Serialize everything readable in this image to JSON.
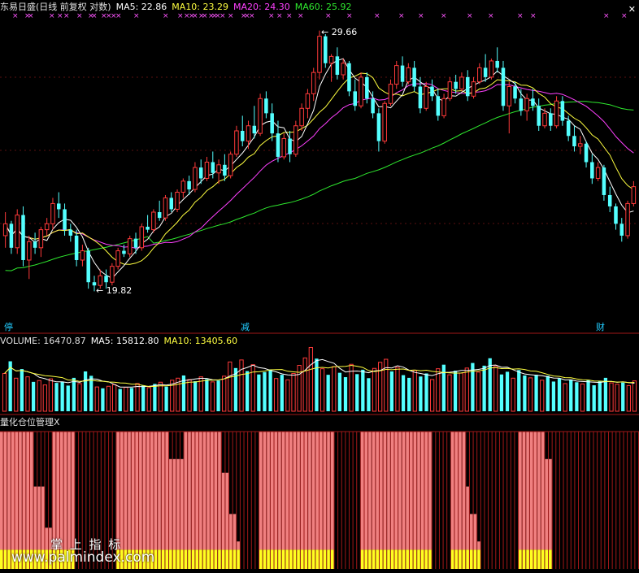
{
  "header": {
    "title": "东易日盛(日线 前复权 对数)",
    "ma5": "MA5: 22.86",
    "ma10": "MA10: 23.29",
    "ma20": "MA20: 24.30",
    "ma60": "MA60: 25.92"
  },
  "price_panel": {
    "high_label": "29.66",
    "low_label": "19.82",
    "close_button": "✕"
  },
  "signal_labels": {
    "left": "停",
    "mid": "减",
    "right": "财"
  },
  "volume_header": {
    "volume": "VOLUME: 16470.87",
    "ma5": "MA5: 15812.80",
    "ma10": "MA10: 13405.60"
  },
  "indicator_title": "量化仓位管理X",
  "watermark": {
    "line1": "掌 上 指 标",
    "line2": "www.palmindex.com"
  },
  "colors": {
    "up": "#ff3a3a",
    "down": "#54ffff",
    "ma5": "#ffffff",
    "ma10": "#ffff40",
    "ma20": "#ff40ff",
    "ma60": "#2ee82e",
    "position_fill": "#f08080",
    "position_base": "#ffff20",
    "grid": "#a01818",
    "marker": "#ff55ff"
  },
  "chart_data": [
    {
      "type": "candlestick",
      "title": "东易日盛(日线 前复权 对数)",
      "y_scale": "log",
      "annotations": [
        {
          "label": "29.66",
          "kind": "max"
        },
        {
          "label": "19.82",
          "kind": "min"
        }
      ],
      "moving_averages": [
        {
          "name": "MA5",
          "last": 22.86
        },
        {
          "name": "MA10",
          "last": 23.29
        },
        {
          "name": "MA20",
          "last": 24.3
        },
        {
          "name": "MA60",
          "last": 25.92
        }
      ],
      "ohlc": [
        [
          21.6,
          22.4,
          21.2,
          22.0
        ],
        [
          22.0,
          22.1,
          21.0,
          21.2
        ],
        [
          21.2,
          22.5,
          21.0,
          22.3
        ],
        [
          22.3,
          22.6,
          20.6,
          20.8
        ],
        [
          20.8,
          21.6,
          20.2,
          21.4
        ],
        [
          21.4,
          21.7,
          21.0,
          21.2
        ],
        [
          21.2,
          21.9,
          20.9,
          21.8
        ],
        [
          21.8,
          22.2,
          21.6,
          22.0
        ],
        [
          22.0,
          22.9,
          21.8,
          22.7
        ],
        [
          22.7,
          23.1,
          22.2,
          22.5
        ],
        [
          22.5,
          22.7,
          21.6,
          21.8
        ],
        [
          21.8,
          22.0,
          21.4,
          21.6
        ],
        [
          21.6,
          21.8,
          20.6,
          20.8
        ],
        [
          20.8,
          21.3,
          20.6,
          21.1
        ],
        [
          21.1,
          21.2,
          19.9,
          20.1
        ],
        [
          20.1,
          20.3,
          19.82,
          20.0
        ],
        [
          20.0,
          20.5,
          19.9,
          20.3
        ],
        [
          20.3,
          20.5,
          19.9,
          20.1
        ],
        [
          20.1,
          20.7,
          20.0,
          20.6
        ],
        [
          20.6,
          21.2,
          20.5,
          21.1
        ],
        [
          21.1,
          21.3,
          20.9,
          21.0
        ],
        [
          21.0,
          21.6,
          20.9,
          21.5
        ],
        [
          21.5,
          21.7,
          21.0,
          21.2
        ],
        [
          21.2,
          22.0,
          21.1,
          21.9
        ],
        [
          21.9,
          22.3,
          21.7,
          21.8
        ],
        [
          21.8,
          22.5,
          21.7,
          22.4
        ],
        [
          22.4,
          22.8,
          22.1,
          22.2
        ],
        [
          22.2,
          23.0,
          22.1,
          22.9
        ],
        [
          22.9,
          23.1,
          22.4,
          22.5
        ],
        [
          22.5,
          23.2,
          22.4,
          23.1
        ],
        [
          23.1,
          23.6,
          22.9,
          23.5
        ],
        [
          23.5,
          23.7,
          23.0,
          23.2
        ],
        [
          23.2,
          24.2,
          23.1,
          24.0
        ],
        [
          24.0,
          24.3,
          23.4,
          23.6
        ],
        [
          23.6,
          24.4,
          23.5,
          24.2
        ],
        [
          24.2,
          24.6,
          23.6,
          23.8
        ],
        [
          23.8,
          24.3,
          23.4,
          24.1
        ],
        [
          24.1,
          24.5,
          23.5,
          23.7
        ],
        [
          23.7,
          24.6,
          23.6,
          24.5
        ],
        [
          24.5,
          25.6,
          24.4,
          25.4
        ],
        [
          25.4,
          26.0,
          24.8,
          25.0
        ],
        [
          25.0,
          25.8,
          24.7,
          25.6
        ],
        [
          25.6,
          26.4,
          25.1,
          25.3
        ],
        [
          25.3,
          26.9,
          25.2,
          26.7
        ],
        [
          26.7,
          27.0,
          25.9,
          26.1
        ],
        [
          26.1,
          26.5,
          25.0,
          25.3
        ],
        [
          25.3,
          25.8,
          24.2,
          24.4
        ],
        [
          24.4,
          25.3,
          24.3,
          25.1
        ],
        [
          25.1,
          25.4,
          24.2,
          24.5
        ],
        [
          24.5,
          25.8,
          24.4,
          25.6
        ],
        [
          25.6,
          26.5,
          25.4,
          26.3
        ],
        [
          26.3,
          27.1,
          25.9,
          26.9
        ],
        [
          26.9,
          28.0,
          26.6,
          27.8
        ],
        [
          27.8,
          29.66,
          27.5,
          29.4
        ],
        [
          29.4,
          29.5,
          28.0,
          28.2
        ],
        [
          28.2,
          28.6,
          27.4,
          28.5
        ],
        [
          28.5,
          28.9,
          27.5,
          27.7
        ],
        [
          27.7,
          28.4,
          27.5,
          28.2
        ],
        [
          28.2,
          28.3,
          26.8,
          27.0
        ],
        [
          27.0,
          27.5,
          26.2,
          26.4
        ],
        [
          26.4,
          27.8,
          26.3,
          27.6
        ],
        [
          27.6,
          27.8,
          26.5,
          26.7
        ],
        [
          26.7,
          27.0,
          25.9,
          26.1
        ],
        [
          26.1,
          26.3,
          24.6,
          25.0
        ],
        [
          25.0,
          26.6,
          24.9,
          26.5
        ],
        [
          26.5,
          27.5,
          26.4,
          27.3
        ],
        [
          27.3,
          28.3,
          27.1,
          28.1
        ],
        [
          28.1,
          28.5,
          27.2,
          27.4
        ],
        [
          27.4,
          28.2,
          27.3,
          28.0
        ],
        [
          28.0,
          28.3,
          27.0,
          27.2
        ],
        [
          27.2,
          27.6,
          26.1,
          26.3
        ],
        [
          26.3,
          27.4,
          26.2,
          27.2
        ],
        [
          27.2,
          27.5,
          26.6,
          26.8
        ],
        [
          26.8,
          27.1,
          25.8,
          26.0
        ],
        [
          26.0,
          26.9,
          25.9,
          26.7
        ],
        [
          26.7,
          27.6,
          26.6,
          27.4
        ],
        [
          27.4,
          27.7,
          26.9,
          27.1
        ],
        [
          27.1,
          27.8,
          27.0,
          27.6
        ],
        [
          27.6,
          27.9,
          26.6,
          26.8
        ],
        [
          26.8,
          27.6,
          26.7,
          27.4
        ],
        [
          27.4,
          28.2,
          27.3,
          28.0
        ],
        [
          28.0,
          28.6,
          27.4,
          27.6
        ],
        [
          27.6,
          28.4,
          27.5,
          28.3
        ],
        [
          28.3,
          28.9,
          27.8,
          28.0
        ],
        [
          28.0,
          28.3,
          26.2,
          26.4
        ],
        [
          26.4,
          27.4,
          25.3,
          27.2
        ],
        [
          27.2,
          27.4,
          26.5,
          26.7
        ],
        [
          26.7,
          27.1,
          26.0,
          26.2
        ],
        [
          26.2,
          26.9,
          25.8,
          26.7
        ],
        [
          26.7,
          27.1,
          26.2,
          26.4
        ],
        [
          26.4,
          26.7,
          25.4,
          25.6
        ],
        [
          25.6,
          26.3,
          25.5,
          26.1
        ],
        [
          26.1,
          26.3,
          25.4,
          25.6
        ],
        [
          25.6,
          26.8,
          25.5,
          26.6
        ],
        [
          26.6,
          26.8,
          25.6,
          25.8
        ],
        [
          25.8,
          26.0,
          25.0,
          25.2
        ],
        [
          25.2,
          25.6,
          24.6,
          24.8
        ],
        [
          24.8,
          25.2,
          24.5,
          24.9
        ],
        [
          24.9,
          25.0,
          24.0,
          24.2
        ],
        [
          24.2,
          24.5,
          23.4,
          23.6
        ],
        [
          23.6,
          24.2,
          23.5,
          24.0
        ],
        [
          24.0,
          24.1,
          22.8,
          23.0
        ],
        [
          23.0,
          23.3,
          22.4,
          22.6
        ],
        [
          22.6,
          22.7,
          21.8,
          22.0
        ],
        [
          22.0,
          22.2,
          21.4,
          21.6
        ],
        [
          21.6,
          22.8,
          21.5,
          22.7
        ],
        [
          22.7,
          23.5,
          22.6,
          23.3
        ]
      ]
    },
    {
      "type": "bar",
      "title": "VOLUME",
      "series_values": {
        "VOLUME": 16470.87,
        "MA5": 15812.8,
        "MA10": 13405.6
      },
      "values": [
        11200,
        14800,
        9800,
        12500,
        10200,
        8700,
        9100,
        7800,
        9600,
        8400,
        8800,
        7600,
        9900,
        8200,
        11800,
        10500,
        7200,
        6800,
        7400,
        7900,
        6600,
        7100,
        6900,
        8200,
        7700,
        7000,
        8100,
        8600,
        7300,
        9200,
        9800,
        10600,
        9400,
        8900,
        10200,
        9500,
        8700,
        9100,
        10400,
        14600,
        12800,
        15200,
        11900,
        13800,
        10900,
        11600,
        12400,
        9700,
        10800,
        9300,
        11200,
        13600,
        15800,
        18900,
        15600,
        12600,
        10800,
        13200,
        11400,
        10100,
        13900,
        11000,
        12300,
        9800,
        12700,
        14500,
        15400,
        11800,
        13000,
        10700,
        9900,
        12100,
        10300,
        11200,
        9400,
        12600,
        13800,
        10800,
        12000,
        11300,
        12800,
        14300,
        11600,
        13500,
        15700,
        13400,
        10900,
        11700,
        9800,
        12200,
        10600,
        9900,
        10800,
        9200,
        10500,
        8800,
        9700,
        8200,
        9400,
        8600,
        8100,
        9300,
        7700,
        8900,
        9900,
        8400,
        8000,
        8500,
        7600,
        9000
      ],
      "up": [
        true,
        false,
        true,
        false,
        true,
        false,
        true,
        true,
        true,
        false,
        false,
        false,
        false,
        true,
        false,
        false,
        true,
        false,
        true,
        true,
        false,
        true,
        false,
        true,
        false,
        true,
        false,
        true,
        false,
        true,
        true,
        false,
        true,
        false,
        true,
        false,
        true,
        false,
        true,
        true,
        false,
        true,
        false,
        true,
        false,
        false,
        false,
        true,
        false,
        true,
        true,
        true,
        true,
        true,
        false,
        true,
        false,
        true,
        false,
        false,
        true,
        false,
        false,
        false,
        true,
        true,
        true,
        false,
        true,
        false,
        false,
        true,
        false,
        false,
        true,
        true,
        false,
        true,
        false,
        true,
        true,
        false,
        true,
        false,
        false,
        true,
        false,
        false,
        true,
        false,
        false,
        true,
        false,
        true,
        false,
        false,
        false,
        true,
        false,
        false,
        true,
        false,
        false,
        false,
        false,
        true,
        true,
        false,
        true,
        true
      ]
    },
    {
      "type": "bar",
      "title": "量化仓位管理X",
      "position_percent": [
        100,
        100,
        100,
        100,
        100,
        100,
        100,
        100,
        100,
        60,
        60,
        60,
        30,
        30,
        100,
        100,
        100,
        100,
        100,
        100,
        0,
        0,
        0,
        0,
        0,
        0,
        0,
        0,
        0,
        0,
        0,
        100,
        100,
        100,
        100,
        100,
        100,
        100,
        100,
        100,
        100,
        100,
        100,
        100,
        100,
        80,
        80,
        80,
        80,
        100,
        100,
        100,
        100,
        100,
        100,
        100,
        100,
        100,
        100,
        70,
        70,
        40,
        40,
        20,
        0,
        0,
        0,
        0,
        0,
        100,
        100,
        100,
        100,
        100,
        100,
        100,
        100,
        100,
        100,
        100,
        100,
        100,
        100,
        100,
        100,
        100,
        100,
        100,
        100,
        0,
        0,
        0,
        0,
        0,
        0,
        0,
        100,
        100,
        100,
        100,
        100,
        100,
        100,
        100,
        100,
        100,
        100,
        100,
        100,
        100,
        100,
        100,
        100,
        100,
        100,
        0,
        0,
        0,
        0,
        0,
        100,
        100,
        100,
        100,
        60,
        40,
        40,
        20,
        0,
        0,
        0,
        0,
        0,
        0,
        0,
        0,
        0,
        0,
        100,
        100,
        100,
        100,
        100,
        100,
        100,
        80,
        80,
        0,
        0,
        0,
        0,
        0,
        0,
        0,
        0,
        0,
        0,
        0,
        0,
        0,
        0,
        0,
        0,
        0,
        0,
        0,
        0,
        0,
        0,
        0
      ],
      "base_percent": 14
    }
  ]
}
